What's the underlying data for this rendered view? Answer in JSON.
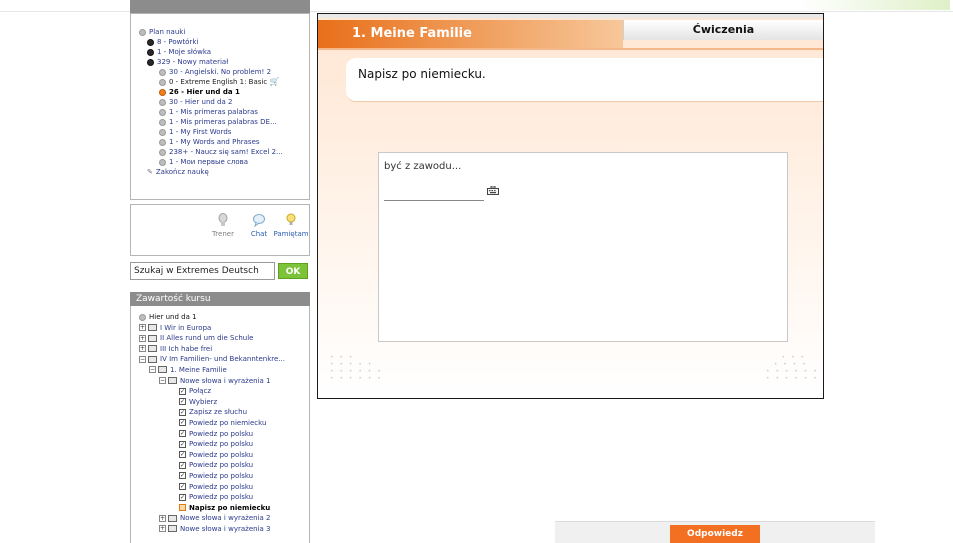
{
  "plan": {
    "items": [
      {
        "label": "Plan nauki"
      },
      {
        "label": "8 - Powtórki"
      },
      {
        "label": "1 - Moje słówka"
      },
      {
        "label": "329 - Nowy materiał"
      },
      {
        "label": "30 - Angielski. No problem! 2"
      },
      {
        "label": "0 - Extreme English 1: Basic"
      },
      {
        "label": "26 - Hier und da 1"
      },
      {
        "label": "30 - Hier und da 2"
      },
      {
        "label": "1 - Mis primeras palabras"
      },
      {
        "label": "1 - Mis primeras palabras DE..."
      },
      {
        "label": "1 - My First Words"
      },
      {
        "label": "1 - My Words and Phrases"
      },
      {
        "label": "238+ - Naucz się sam! Excel 2..."
      },
      {
        "label": "1 - Мои первые слова"
      },
      {
        "label": "Zakończ naukę"
      }
    ]
  },
  "tools": {
    "trener": "Trener",
    "chat": "Chat",
    "pamietam": "Pamiętam"
  },
  "search": {
    "value": "Szukaj w Extremes Deutsch",
    "ok_label": "OK"
  },
  "course": {
    "heading": "Zawartość kursu",
    "items": [
      {
        "label": "Hier und da 1"
      },
      {
        "label": "I Wir in Europa"
      },
      {
        "label": "II Alles rund um die Schule"
      },
      {
        "label": "III Ich habe frei"
      },
      {
        "label": "IV Im Familien- und Bekanntenkre..."
      },
      {
        "label": "1. Meine Familie"
      },
      {
        "label": "Nowe słowa i wyrażenia 1"
      },
      {
        "label": "Połącz"
      },
      {
        "label": "Wybierz"
      },
      {
        "label": "Zapisz ze słuchu"
      },
      {
        "label": "Powiedz po niemiecku"
      },
      {
        "label": "Powiedz po polsku"
      },
      {
        "label": "Powiedz po polsku"
      },
      {
        "label": "Powiedz po polsku"
      },
      {
        "label": "Powiedz po polsku"
      },
      {
        "label": "Powiedz po polsku"
      },
      {
        "label": "Powiedz po polsku"
      },
      {
        "label": "Powiedz po polsku"
      },
      {
        "label": "Napisz po niemiecku"
      },
      {
        "label": "Nowe słowa i wyrażenia 2"
      },
      {
        "label": "Nowe słowa i wyrażenia 3"
      }
    ]
  },
  "exercise": {
    "title": "1. Meine Familie",
    "tab": "Ćwiczenia",
    "instruction": "Napisz po niemiecku.",
    "question": "być z zawodu...",
    "answer_value": "",
    "reply_label": "Odpowiedz"
  },
  "colors": {
    "accent": "#f36f21",
    "ok_green": "#7cc33a",
    "panel_header": "#8c8c8c",
    "link": "#2b3a8c"
  }
}
